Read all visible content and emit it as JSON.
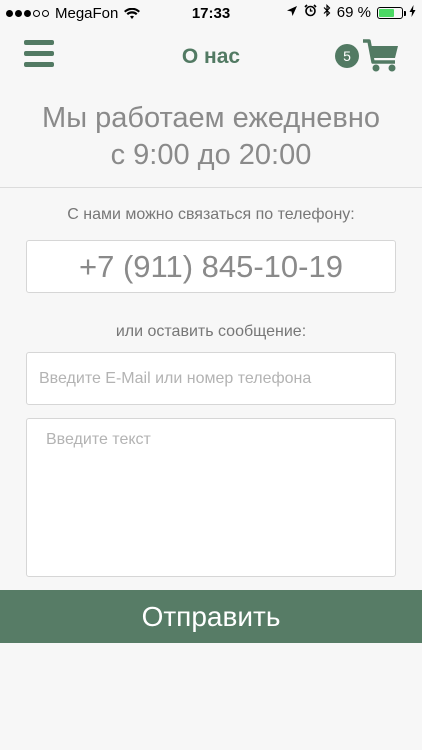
{
  "status_bar": {
    "carrier": "MegaFon",
    "time": "17:33",
    "battery_percent": "69 %",
    "battery_level": 0.69,
    "battery_color": "#4cd964",
    "icons": [
      "signal-dots-icon",
      "wifi-icon",
      "location-arrow-icon",
      "alarm-icon",
      "bluetooth-icon",
      "battery-icon",
      "charging-bolt-icon"
    ]
  },
  "nav": {
    "title": "О нас",
    "cart_count": "5",
    "menu_icon": "hamburger-menu-icon",
    "cart_icon": "shopping-cart-icon",
    "accent_color": "#527a63"
  },
  "content": {
    "hours_line1": "Мы работаем ежедневно",
    "hours_line2": "с 9:00 до 20:00",
    "contact_label": "С нами можно связаться по телефону:",
    "phone": "+7 (911) 845-10-19",
    "message_label": "или оставить сообщение:"
  },
  "form": {
    "email_placeholder": "Введите E-Mail или номер телефона",
    "email_value": "",
    "text_placeholder": "Введите текст",
    "text_value": "",
    "submit_label": "Отправить",
    "submit_color": "#577c66"
  }
}
